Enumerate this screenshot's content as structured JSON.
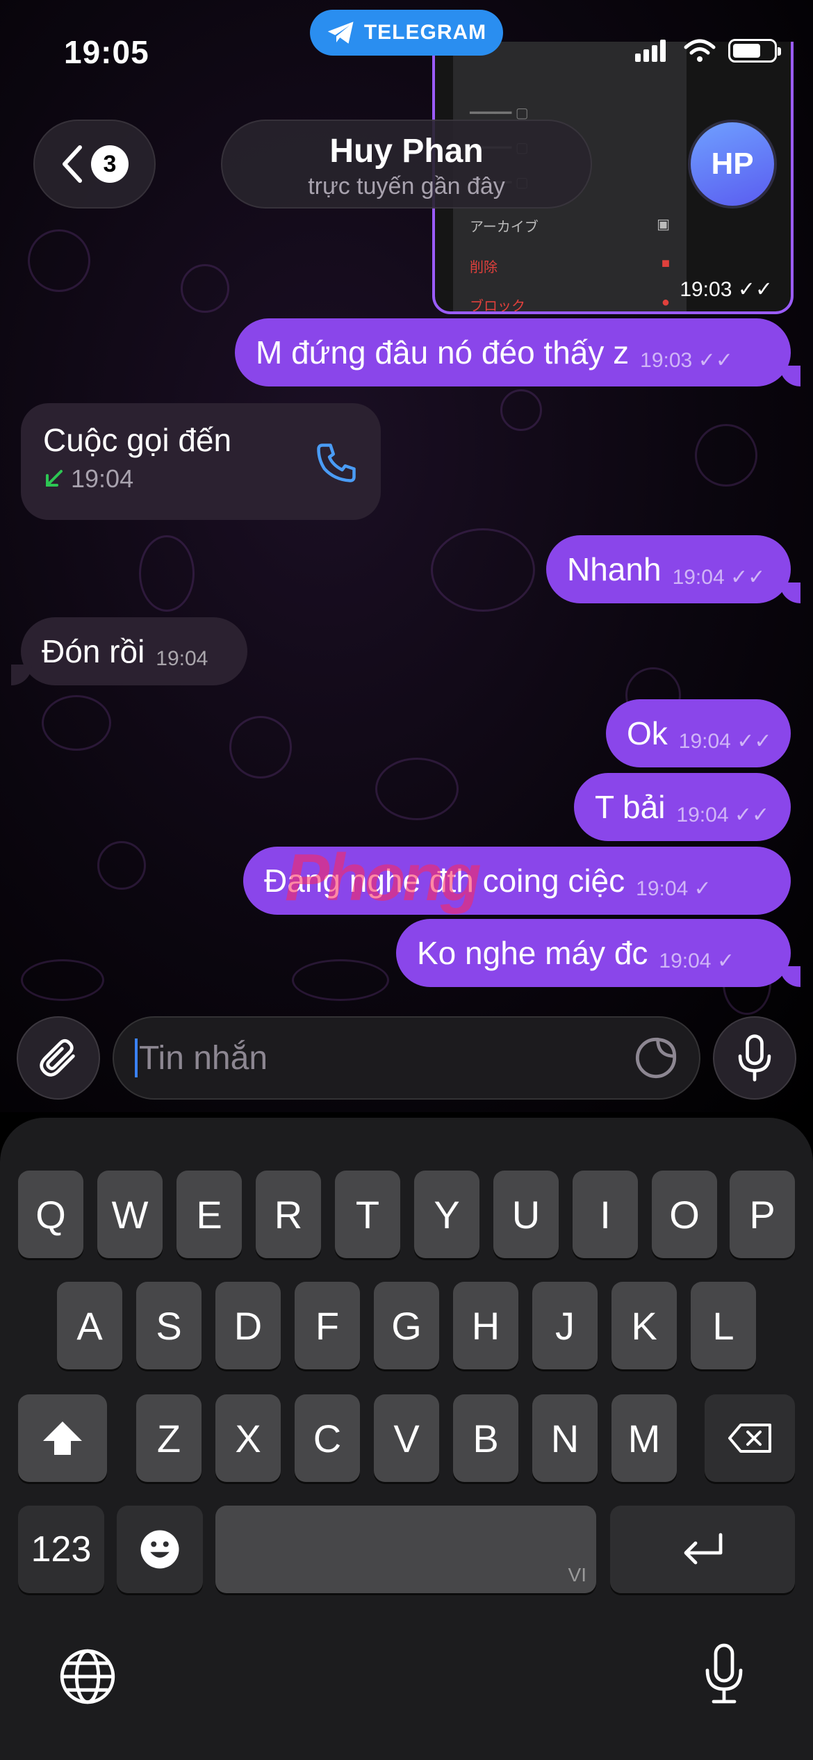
{
  "status_bar": {
    "time": "19:05",
    "banner": "TELEGRAM"
  },
  "header": {
    "back_count": "3",
    "contact_name": "Huy Phan",
    "contact_status": "trực tuyến gần đây",
    "avatar_initials": "HP"
  },
  "image_message": {
    "menu_items": [
      "アーカイブ",
      "削除",
      "ブロック"
    ],
    "time": "19:03"
  },
  "messages": [
    {
      "text": "M đứng đâu nó đéo thấy z",
      "time": "19:03",
      "direction": "out",
      "read": true
    },
    {
      "text": "Nhanh",
      "time": "19:04",
      "direction": "out",
      "read": true
    },
    {
      "text": "Đón rồi",
      "time": "19:04",
      "direction": "in"
    },
    {
      "text": "Ok",
      "time": "19:04",
      "direction": "out",
      "read": true
    },
    {
      "text": "T bải",
      "time": "19:04",
      "direction": "out",
      "read": true
    },
    {
      "text": "Đang nghe đth coing ciệc",
      "time": "19:04",
      "direction": "out",
      "read": false
    },
    {
      "text": "Ko nghe máy đc",
      "time": "19:04",
      "direction": "out",
      "read": false
    }
  ],
  "call": {
    "title": "Cuộc gọi đến",
    "time": "19:04"
  },
  "watermark": "Phong",
  "composer": {
    "placeholder": "Tin nhắn"
  },
  "keyboard": {
    "row1": [
      "Q",
      "W",
      "E",
      "R",
      "T",
      "Y",
      "U",
      "I",
      "O",
      "P"
    ],
    "row2": [
      "A",
      "S",
      "D",
      "F",
      "G",
      "H",
      "J",
      "K",
      "L"
    ],
    "row3": [
      "Z",
      "X",
      "C",
      "V",
      "B",
      "N",
      "M"
    ],
    "numbers_key": "123",
    "space_lang": "VI"
  },
  "colors": {
    "outgoing_bubble": "#8a46ea",
    "incoming_bubble": "#2b2130",
    "telegram_blue": "#2a8ef0",
    "keyboard_bg": "#1c1c1e"
  }
}
